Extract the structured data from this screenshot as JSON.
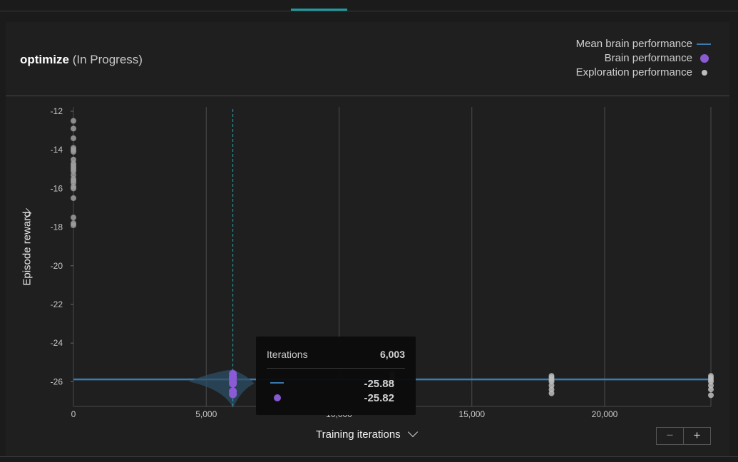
{
  "header": {
    "title_bold": "optimize",
    "title_status": "(In Progress)"
  },
  "legend": [
    {
      "label": "Mean brain performance",
      "marker": "line",
      "color": "#3b7bb0"
    },
    {
      "label": "Brain performance",
      "marker": "dot",
      "color": "#8b5bd6"
    },
    {
      "label": "Exploration performance",
      "marker": "small-dot",
      "color": "#bdbdbd"
    }
  ],
  "axes": {
    "y_title": "Episode reward",
    "x_title": "Training iterations"
  },
  "zoom": {
    "out": "−",
    "in": "+"
  },
  "tooltip": {
    "header_label": "Iterations",
    "header_value": "6,003",
    "mean_value": "-25.88",
    "brain_value": "-25.82"
  },
  "chart_data": {
    "type": "scatter",
    "xlabel": "Training iterations",
    "ylabel": "Episode reward",
    "xlim": [
      0,
      24000
    ],
    "ylim": [
      -27.5,
      -12
    ],
    "x_ticks": [
      0,
      5000,
      10000,
      15000,
      20000
    ],
    "x_tick_labels": [
      "0",
      "5,000",
      "10,000",
      "15,000",
      "20,000"
    ],
    "y_ticks": [
      -12,
      -14,
      -16,
      -18,
      -20,
      -22,
      -24,
      -26
    ],
    "y_tick_labels": [
      "-12",
      "-14",
      "-16",
      "-18",
      "-20",
      "-22",
      "-24",
      "-26"
    ],
    "series": [
      {
        "name": "Mean brain performance",
        "kind": "line",
        "x": [
          0,
          24000
        ],
        "y": [
          -25.88,
          -25.88
        ]
      },
      {
        "name": "Brain performance",
        "kind": "dot",
        "x": [
          6003,
          6003,
          6003,
          6003,
          6003,
          6003,
          6003
        ],
        "y": [
          -25.6,
          -25.75,
          -25.82,
          -26.0,
          -26.1,
          -26.5,
          -26.65
        ]
      },
      {
        "name": "Exploration performance",
        "kind": "small-dot",
        "x": [
          0,
          0,
          0,
          0,
          0,
          0,
          0,
          0,
          0,
          0,
          0,
          0,
          0,
          0,
          0,
          0,
          0,
          0,
          0,
          0,
          0,
          0,
          12000,
          12000,
          12000,
          12000,
          12000,
          18000,
          18000,
          18000,
          18000,
          18000,
          18000,
          18000,
          24000,
          24000,
          24000,
          24000,
          24000,
          24000,
          24000
        ],
        "y": [
          -12.5,
          -12.9,
          -13.4,
          -13.9,
          -14.0,
          -14.1,
          -14.5,
          -14.7,
          -14.8,
          -14.9,
          -15.0,
          -15.1,
          -15.3,
          -15.5,
          -15.6,
          -15.7,
          -15.9,
          -16.0,
          -16.5,
          -17.5,
          -17.8,
          -17.9,
          -25.6,
          -25.8,
          -26.0,
          -26.3,
          -26.6,
          -25.7,
          -25.8,
          -25.9,
          -26.0,
          -26.2,
          -26.4,
          -26.6,
          -25.7,
          -25.8,
          -25.9,
          -26.0,
          -26.2,
          -26.4,
          -26.7
        ]
      }
    ],
    "selected_x": 6003
  }
}
